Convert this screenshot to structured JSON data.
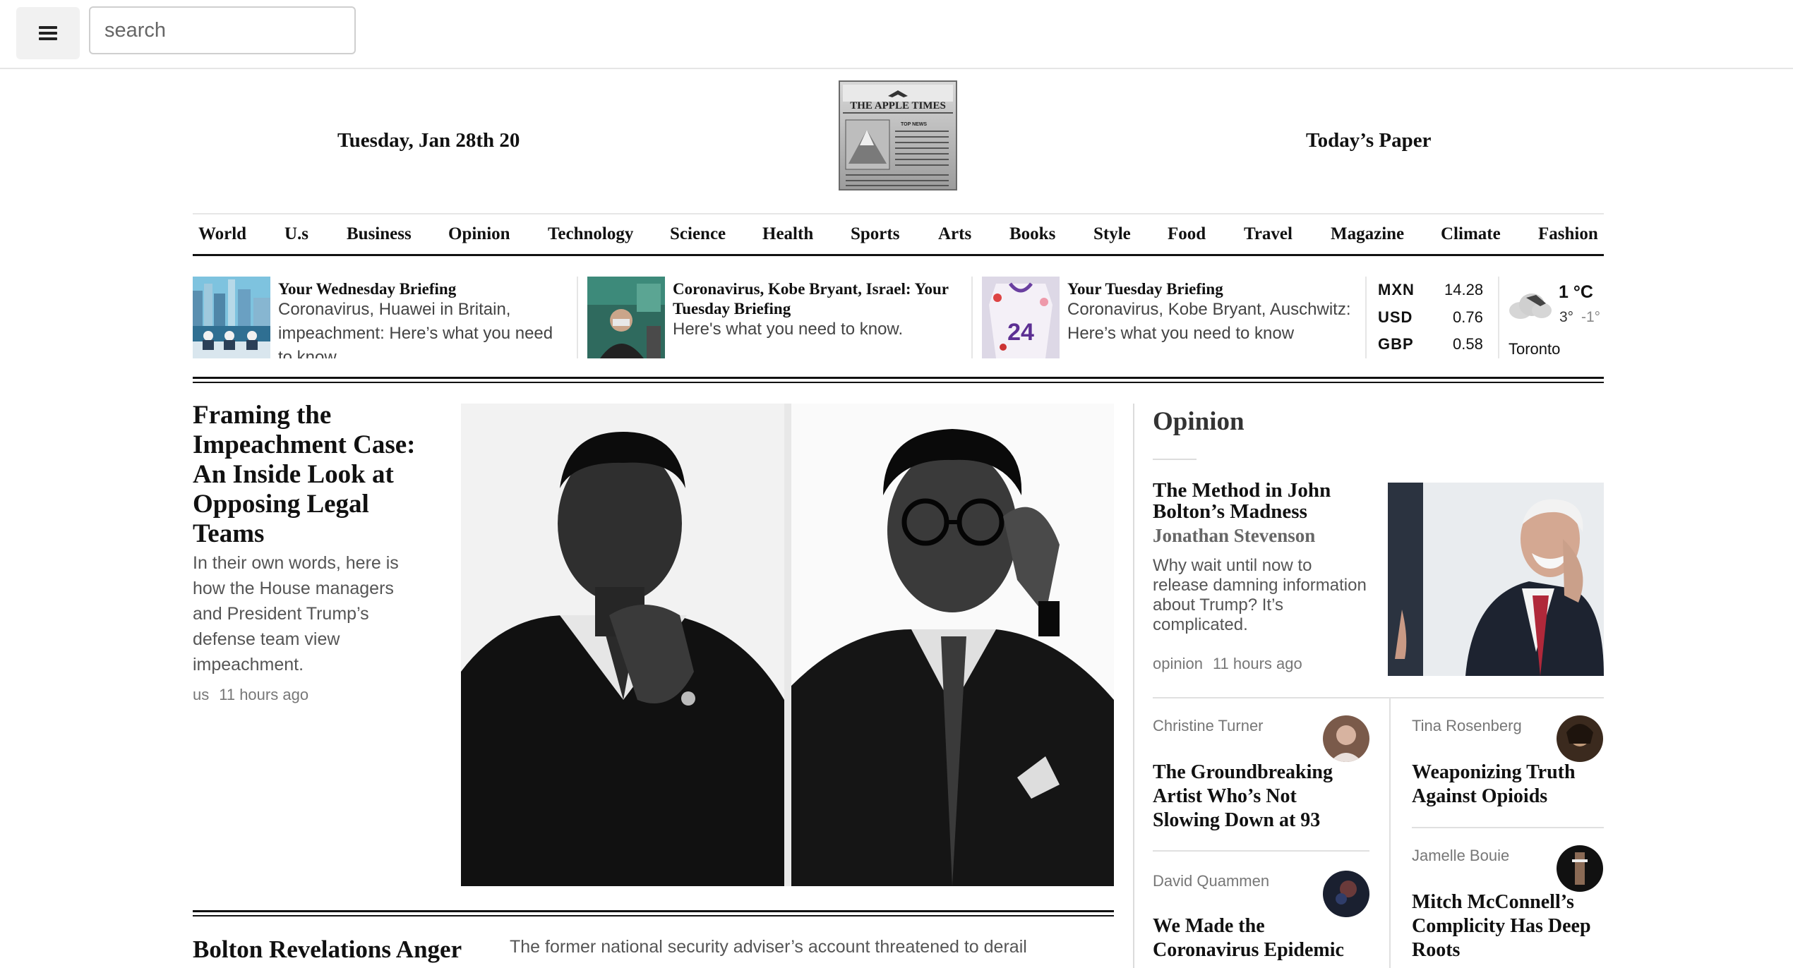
{
  "search": {
    "placeholder": "search"
  },
  "masthead": {
    "date": "Tuesday, Jan 28th 20",
    "todays_paper": "Today’s Paper",
    "logo_text": "THE APPLE TIMES",
    "logo_subtext": "TOP NEWS"
  },
  "nav": [
    {
      "label": "World"
    },
    {
      "label": "U.s"
    },
    {
      "label": "Business"
    },
    {
      "label": "Opinion"
    },
    {
      "label": "Technology"
    },
    {
      "label": "Science"
    },
    {
      "label": "Health"
    },
    {
      "label": "Sports"
    },
    {
      "label": "Arts"
    },
    {
      "label": "Books"
    },
    {
      "label": "Style"
    },
    {
      "label": "Food"
    },
    {
      "label": "Travel"
    },
    {
      "label": "Magazine"
    },
    {
      "label": "Climate"
    },
    {
      "label": "Fashion"
    }
  ],
  "briefings": [
    {
      "title": "Your Wednesday Briefing",
      "desc": "Coronavirus, Huawei in Britain, impeachment: Here’s what you need to know"
    },
    {
      "title": "Coronavirus, Kobe Bryant, Israel: Your Tuesday Briefing",
      "desc": "Here's what you need to know."
    },
    {
      "title": "Your Tuesday Briefing",
      "desc": "Coronavirus, Kobe Bryant, Auschwitz: Here’s what you need to know"
    }
  ],
  "currencies": [
    {
      "code": "MXN",
      "value": "14.28"
    },
    {
      "code": "USD",
      "value": "0.76"
    },
    {
      "code": "GBP",
      "value": "0.58"
    }
  ],
  "weather": {
    "temp": "1 °C",
    "high": "3°",
    "low": "-1°",
    "city": "Toronto"
  },
  "lead": {
    "title": "Framing the Impeachment Case: An Inside Look at Opposing Legal Teams",
    "desc": "In their own words, here is how the House managers and President Trump’s defense team view impeachment.",
    "section": "us",
    "time": "11 hours ago"
  },
  "second_story": {
    "title": "Bolton Revelations Anger",
    "desc": "The former national security adviser’s account threatened to derail"
  },
  "opinion": {
    "heading": "Opinion",
    "featured": {
      "title": "The Method in John Bolton’s Madness",
      "author": "Jonathan Stevenson",
      "desc": "Why wait until now to release damning information about Trump? It’s complicated.",
      "section": "opinion",
      "time": "11 hours ago"
    },
    "columns": [
      {
        "author": "Christine Turner",
        "title": "The Groundbreaking Artist Who’s Not Slowing Down at 93"
      },
      {
        "author": "Tina Rosenberg",
        "title": "Weaponizing Truth Against Opioids"
      },
      {
        "author": "David Quammen",
        "title": "We Made the Coronavirus Epidemic"
      },
      {
        "author": "Jamelle Bouie",
        "title": "Mitch McConnell’s Complicity Has Deep Roots"
      }
    ]
  }
}
